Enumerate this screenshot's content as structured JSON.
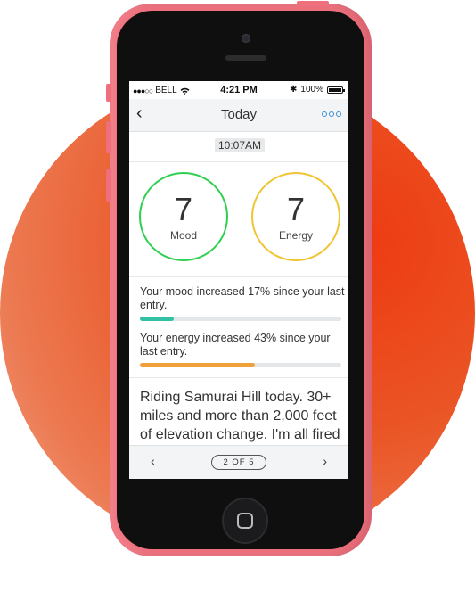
{
  "status_bar": {
    "carrier_signal": "●●●○○",
    "carrier": "BELL",
    "time": "4:21 PM",
    "bluetooth": "✱",
    "battery": "100%"
  },
  "nav": {
    "title": "Today",
    "back_icon": "chevron-left-icon",
    "more_icon": "more-circles-icon"
  },
  "entry_time": "10:07AM",
  "mood": {
    "value": "7",
    "label": "Mood",
    "color": "#2fcf50"
  },
  "energy": {
    "value": "7",
    "label": "Energy",
    "color": "#f0c432"
  },
  "stats": {
    "mood_text": "Your mood increased 17% since your last entry.",
    "mood_progress": 0.17,
    "energy_text": "Your energy increased 43% since your last entry.",
    "energy_progress": 0.57
  },
  "entry_text": "Riding Samurai Hill today. 30+ miles and more than 2,000 feet of elevation change. I'm all fired up and ready to go!",
  "pager": {
    "prev": "‹",
    "next": "›",
    "label": "2 OF 5"
  },
  "colors": {
    "mood_bar": "#31c2a6",
    "energy_bar": "#f0a03a",
    "accent": "#3a8fd6",
    "phone_case": "#f06f7c"
  }
}
